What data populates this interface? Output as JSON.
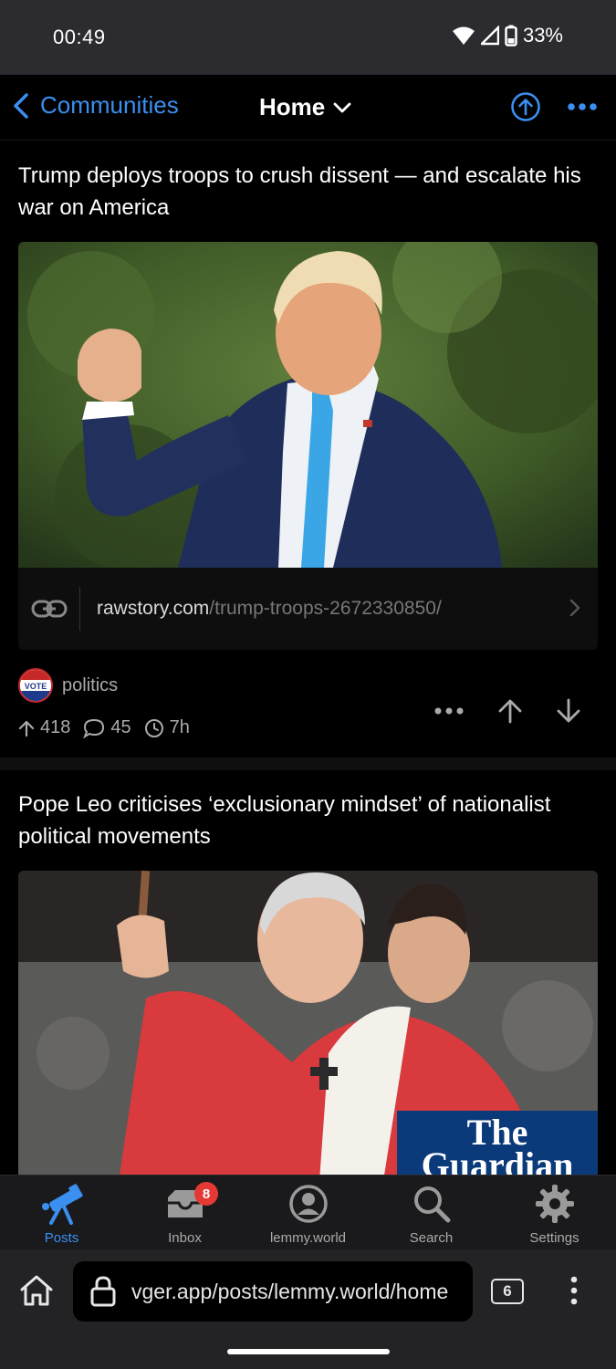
{
  "status_bar": {
    "time": "00:49",
    "battery": "33%"
  },
  "nav": {
    "back_label": "Communities",
    "title": "Home"
  },
  "posts": [
    {
      "title": "Trump deploys troops to crush dissent — and escalate his war on America",
      "image_alt": "Man in navy suit and blue tie raising a fist",
      "link_domain": "rawstory.com",
      "link_path": "/trump-troops-2672330850/",
      "community": "politics",
      "community_avatar_text": "VOTE",
      "score": "418",
      "comments": "45",
      "age": "7h"
    },
    {
      "title": "Pope Leo criticises ‘exclusionary mindset’ of nationalist political movements",
      "image_alt": "Pope in red vestments raising his hand",
      "watermark_line1": "The",
      "watermark_line2": "Guardian"
    }
  ],
  "tabs": [
    {
      "label": "Posts",
      "icon": "telescope-icon",
      "active": true
    },
    {
      "label": "Inbox",
      "icon": "inbox-icon",
      "badge": "8"
    },
    {
      "label": "lemmy.world",
      "icon": "account-icon"
    },
    {
      "label": "Search",
      "icon": "search-icon"
    },
    {
      "label": "Settings",
      "icon": "gear-icon"
    }
  ],
  "browser": {
    "url": "vger.app/posts/lemmy.world/home",
    "tab_count": "6"
  },
  "colors": {
    "accent": "#3b8ff0",
    "background": "#000000",
    "badge": "#e53935"
  }
}
